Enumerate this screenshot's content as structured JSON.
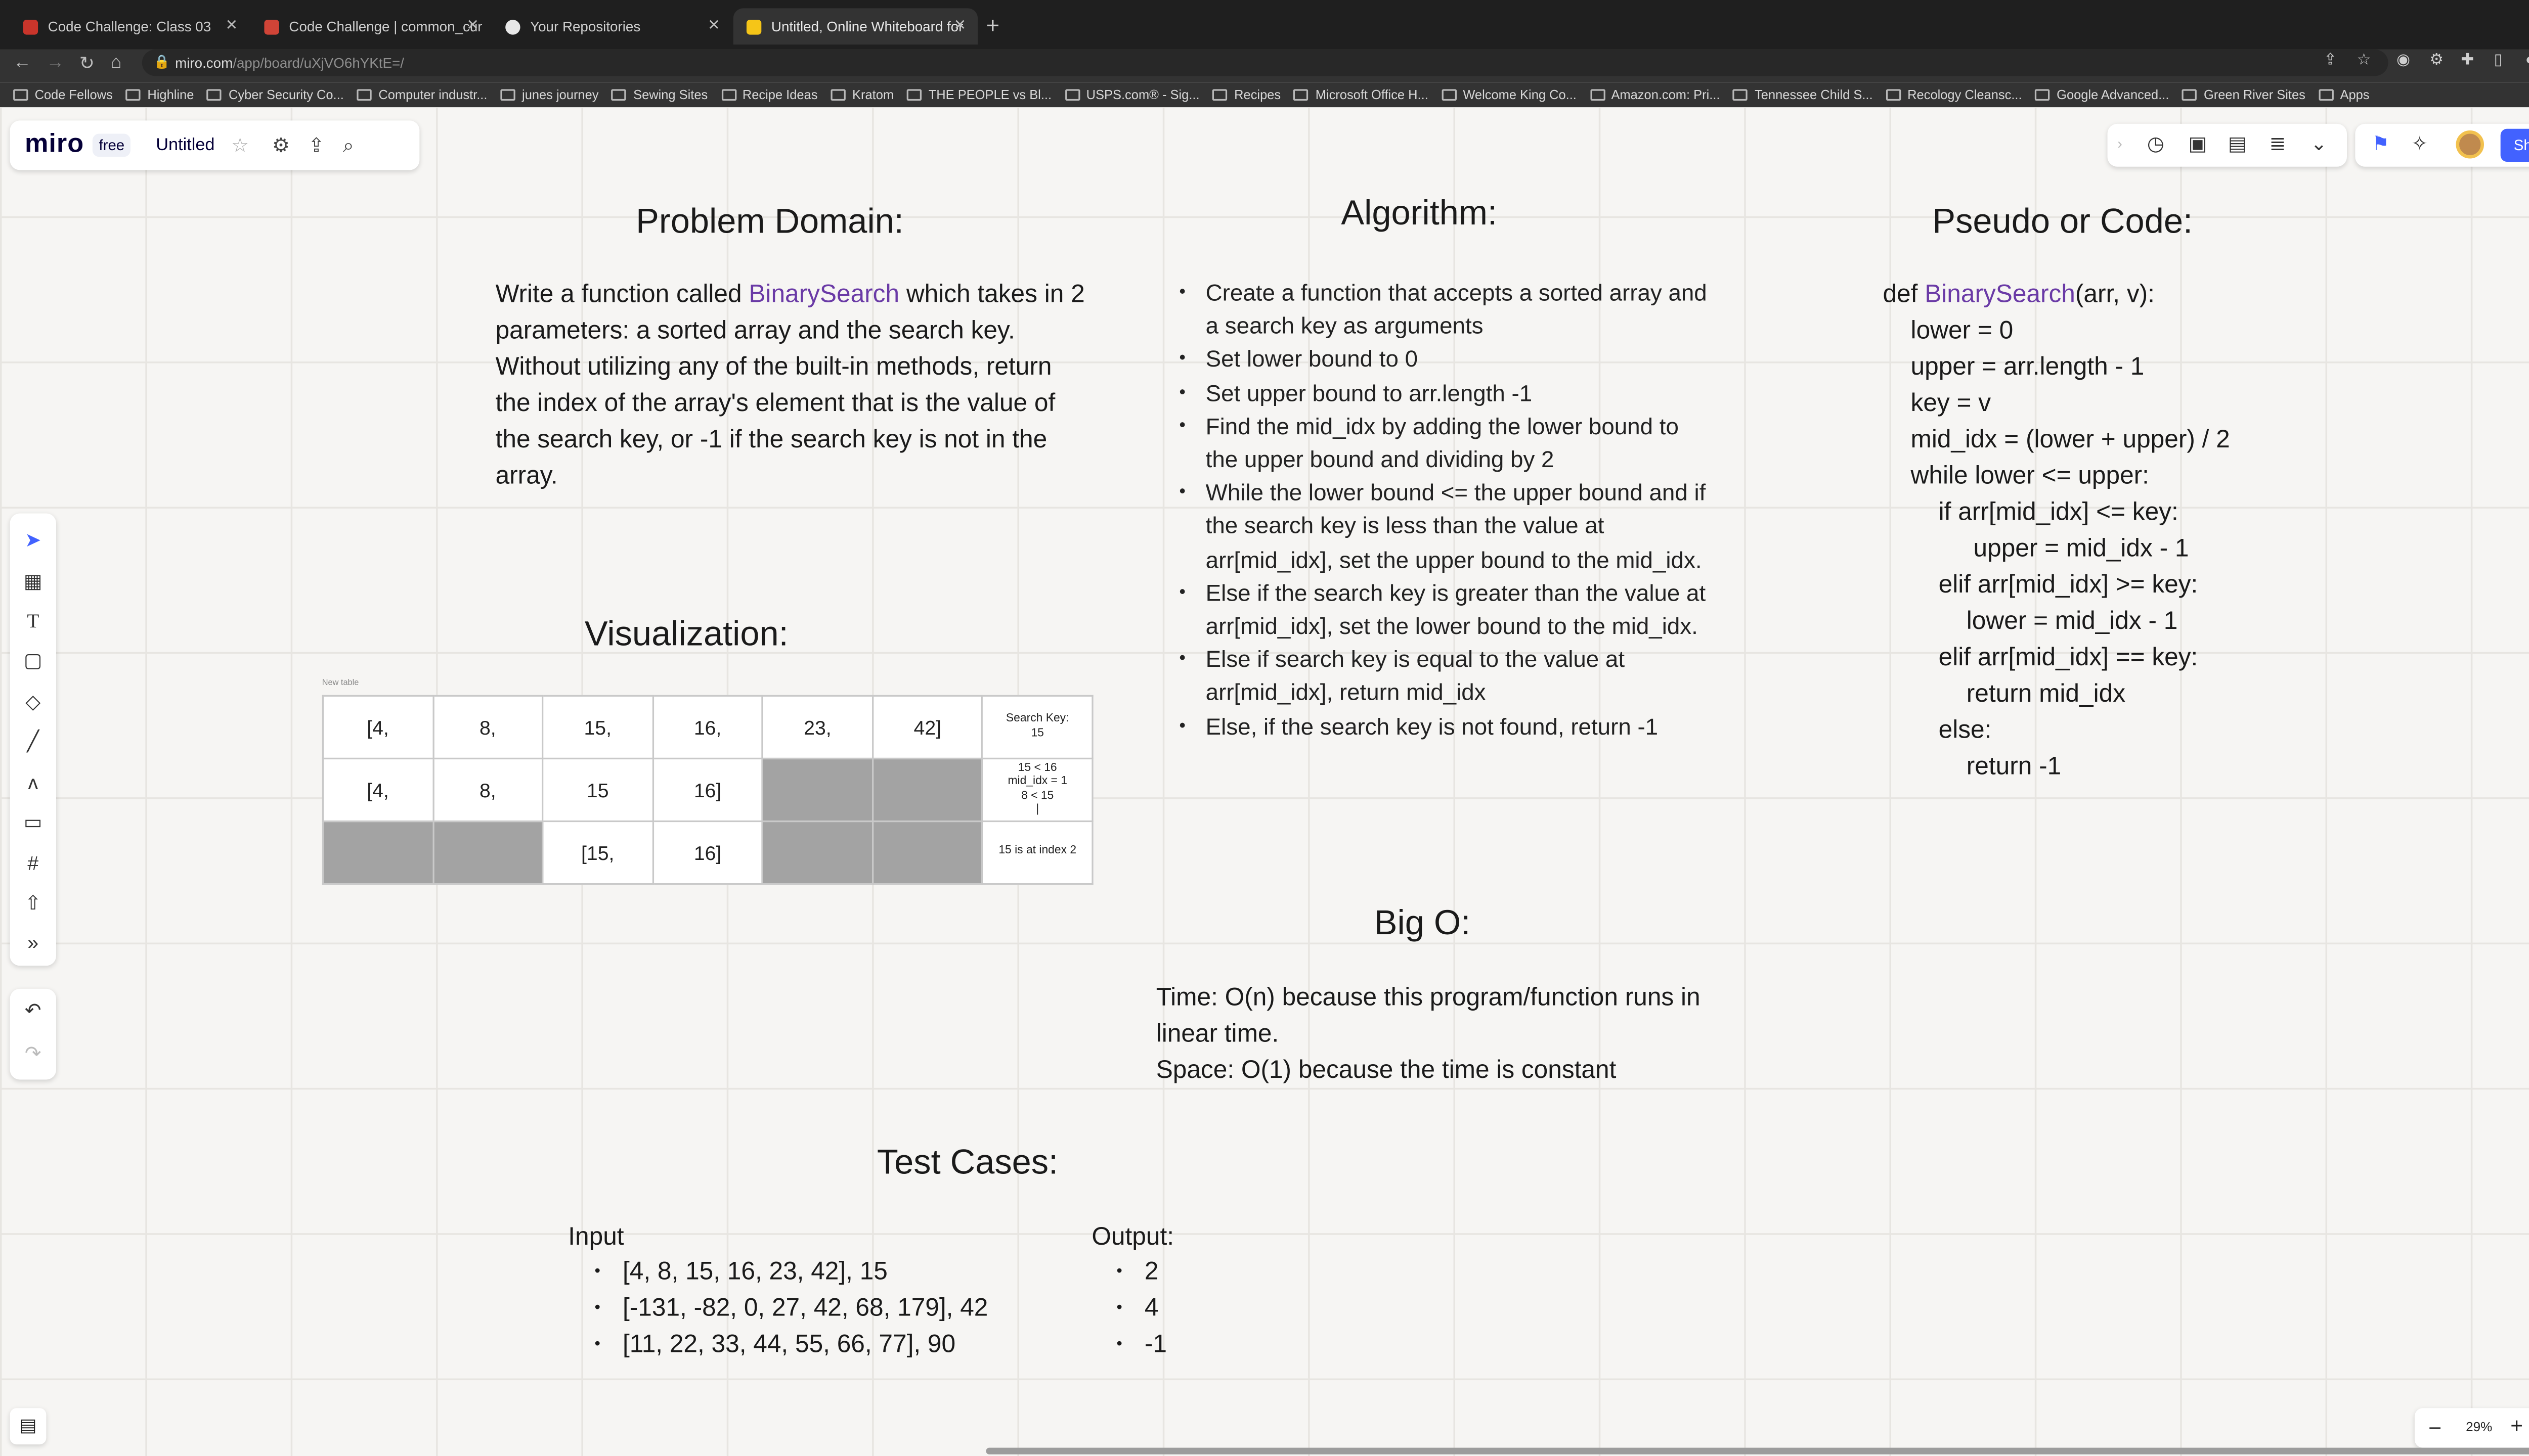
{
  "browser": {
    "tabs": [
      {
        "label": "Code Challenge: Class 03",
        "color": "#c9352b"
      },
      {
        "label": "Code Challenge | common_cur",
        "color": "#d04437"
      },
      {
        "label": "Your Repositories",
        "color": "#e8e8e8"
      },
      {
        "label": "Untitled, Online Whiteboard for",
        "color": "#f5c518"
      }
    ],
    "url_host": "miro.com",
    "url_path": "/app/board/uXjVO6hYKtE=/",
    "bookmarks": [
      "Code Fellows",
      "Highline",
      "Cyber Security Co...",
      "Computer industr...",
      "junes journey",
      "Sewing Sites",
      "Recipe Ideas",
      "Kratom",
      "THE PEOPLE vs Bl...",
      "USPS.com® - Sig...",
      "Recipes",
      "Microsoft Office H...",
      "Welcome King Co...",
      "Amazon.com: Pri...",
      "Tennessee Child S...",
      "Recology Cleansc...",
      "Google Advanced...",
      "Green River Sites",
      "Apps"
    ]
  },
  "miro": {
    "logo": "miro",
    "plan": "free",
    "board_name": "Untitled",
    "share_label": "Share",
    "zoom": "29%",
    "zoom_out": "–",
    "zoom_in": "+",
    "help": "?"
  },
  "board": {
    "problem_title": "Problem Domain:",
    "problem_text_before": "Write a function called ",
    "problem_fn": "BinarySearch",
    "problem_text_after": " which takes in 2 parameters: a sorted array and the search key. Without utilizing any of the built-in methods, return the index of the array's element that is the value of the search key, or -1 if the search key is not in the array.",
    "algorithm_title": "Algorithm:",
    "algorithm": [
      "Create a function that accepts a sorted array and a search key as arguments",
      "Set lower bound to 0",
      "Set upper bound to arr.length -1",
      "Find the mid_idx by adding the lower bound to the upper bound and dividing by 2",
      "While the lower bound <= the upper bound and if the search key is less than the value at arr[mid_idx], set the upper bound to the mid_idx.",
      "Else if the search key is greater than the value at arr[mid_idx], set the lower bound to the mid_idx.",
      "Else if search key is equal to the value at arr[mid_idx], return mid_idx",
      "Else, if the search key is not found, return -1"
    ],
    "code_title": "Pseudo or Code:",
    "code_def_pre": "def ",
    "code_def_fn": "BinarySearch",
    "code_def_post": "(arr, v):",
    "code_lines": [
      "    lower = 0",
      "    upper = arr.length - 1",
      "    key = v",
      "    mid_idx = (lower + upper) / 2",
      "    while lower <= upper:",
      "        if arr[mid_idx] <= key:",
      "             upper = mid_idx - 1",
      "        elif arr[mid_idx] >= key:",
      "            lower = mid_idx - 1",
      "        elif arr[mid_idx] == key:",
      "            return mid_idx",
      "        else:",
      "            return -1"
    ],
    "viz_title": "Visualization:",
    "viz_table_label": "New table",
    "viz_rows": [
      [
        "[4,",
        "8,",
        "15,",
        "16,",
        "23,",
        "42]",
        "Search Key:\n15"
      ],
      [
        "[4,",
        "8,",
        "15",
        "16]",
        "",
        "",
        "15 < 16\nmid_idx = 1\n8 < 15\n|"
      ],
      [
        "",
        "",
        "[15,",
        "16]",
        "",
        "",
        "15 is at index 2"
      ]
    ],
    "bigo_title": "Big O:",
    "bigo_time": "Time: O(n) because this program/function runs in linear time.",
    "bigo_space": "Space: O(1) because the time is constant",
    "tests_title": "Test Cases:",
    "input_label": "Input",
    "inputs": [
      "[4, 8, 15, 16, 23, 42], 15",
      "[-131, -82, 0, 27, 42, 68, 179], 42",
      "[11, 22, 33, 44, 55, 66, 77], 90"
    ],
    "output_label": "Output:",
    "outputs": [
      "2",
      "4",
      "-1"
    ]
  }
}
